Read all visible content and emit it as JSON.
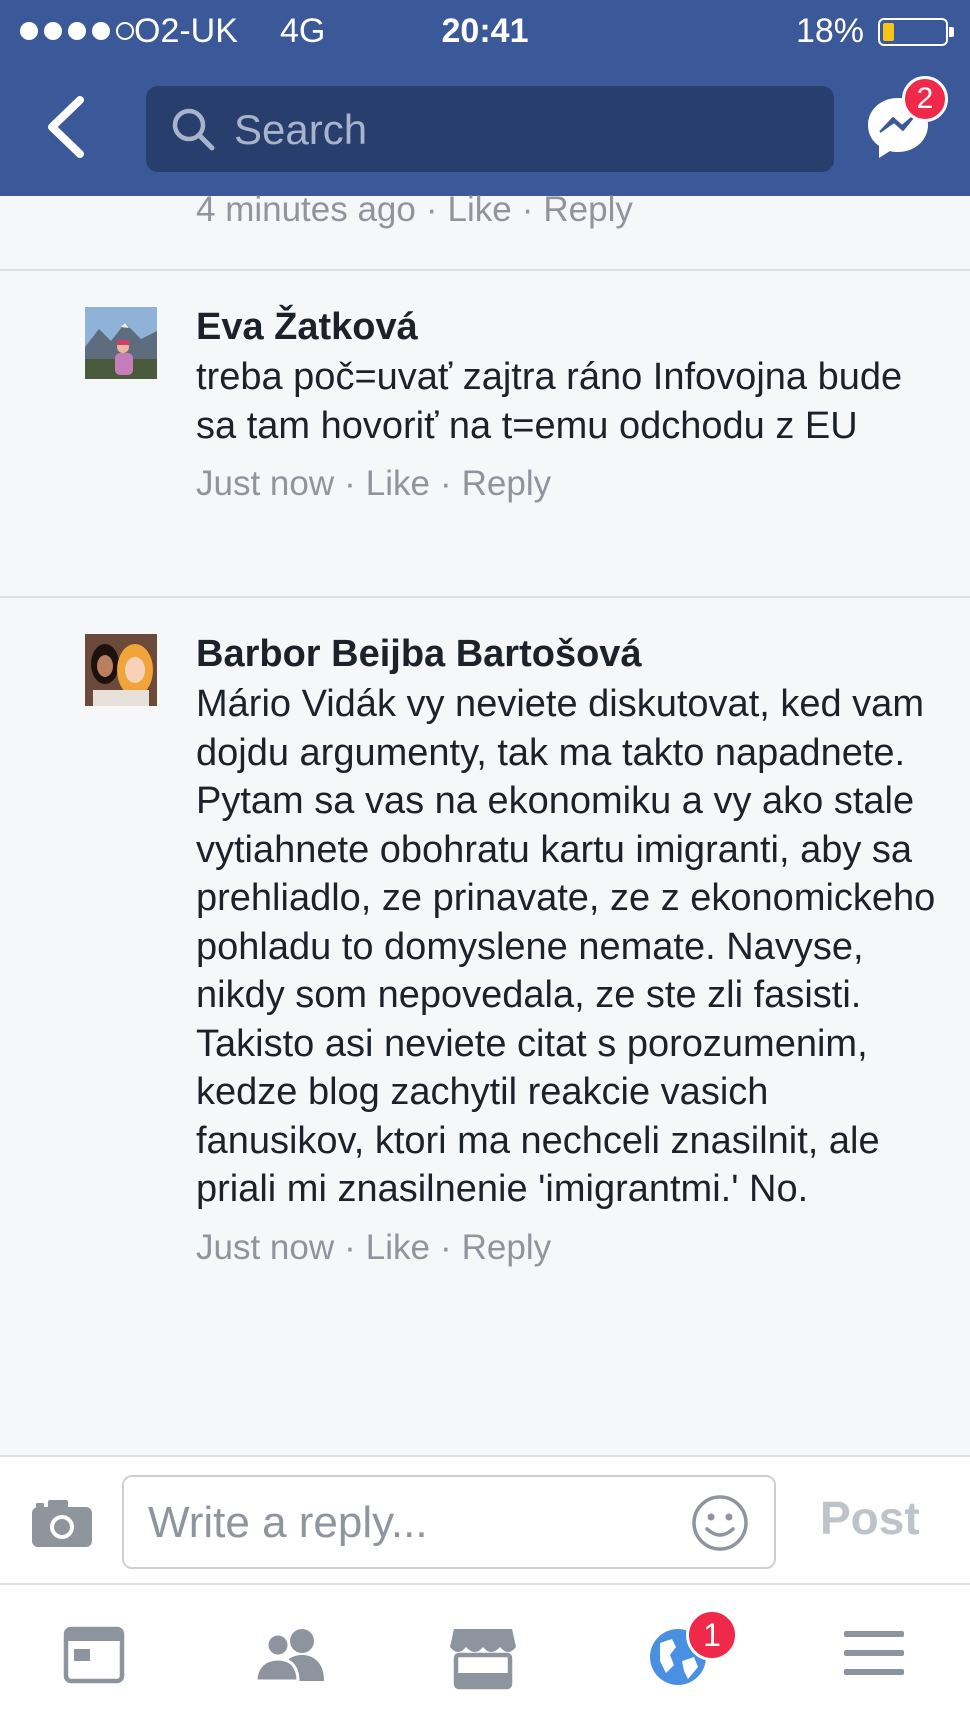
{
  "status_bar": {
    "carrier": "O2-UK",
    "network": "4G",
    "time": "20:41",
    "battery_percent": "18%",
    "battery_level": 0.18,
    "signal_bars": 4,
    "signal_max": 5
  },
  "nav": {
    "search_placeholder": "Search",
    "messenger_badge": "2",
    "back_icon": "chevron-left-icon",
    "messenger_icon": "messenger-icon"
  },
  "previous_comment": {
    "timestamp": "4 minutes ago",
    "like_label": "Like",
    "reply_label": "Reply"
  },
  "comments": [
    {
      "author": "Eva Žatková",
      "text": "treba poč=uvať zajtra ráno Infovojna bude sa tam hovoriť na t=emu odchodu z EU",
      "timestamp": "Just now",
      "like_label": "Like",
      "reply_label": "Reply"
    },
    {
      "author": "Barbor Beijba Bartošová",
      "text": "Mário Vidák vy neviete diskutovat, ked vam dojdu argumenty, tak ma takto napadnete. Pytam sa vas na ekonomiku a vy ako stale vytiahnete obohratu kartu imigranti, aby sa prehliadlo, ze prinavate, ze z ekonomickeho pohladu to domyslene nemate. Navyse, nikdy som nepovedala, ze ste zli fasisti. Takisto asi neviete citat s porozumenim, kedze blog zachytil reakcie vasich fanusikov, ktori ma nechceli znasilnit, ale priali mi znasilnenie 'imigrantmi.' No.",
      "timestamp": "Just now",
      "like_label": "Like",
      "reply_label": "Reply"
    }
  ],
  "composer": {
    "placeholder": "Write a reply...",
    "post_label": "Post",
    "camera_icon": "camera-icon",
    "emoji_icon": "smiley-icon"
  },
  "tab_bar": {
    "tabs": [
      {
        "icon": "news-feed-icon"
      },
      {
        "icon": "friends-icon"
      },
      {
        "icon": "marketplace-icon"
      },
      {
        "icon": "notifications-globe-icon",
        "badge": "1"
      },
      {
        "icon": "menu-icon"
      }
    ]
  },
  "colors": {
    "header_bg": "#3b5998",
    "search_bg": "#283e6d",
    "badge_red": "#f02849",
    "meta_gray": "#90949c",
    "text_dark": "#1d2129",
    "globe_blue": "#4a90e2"
  }
}
